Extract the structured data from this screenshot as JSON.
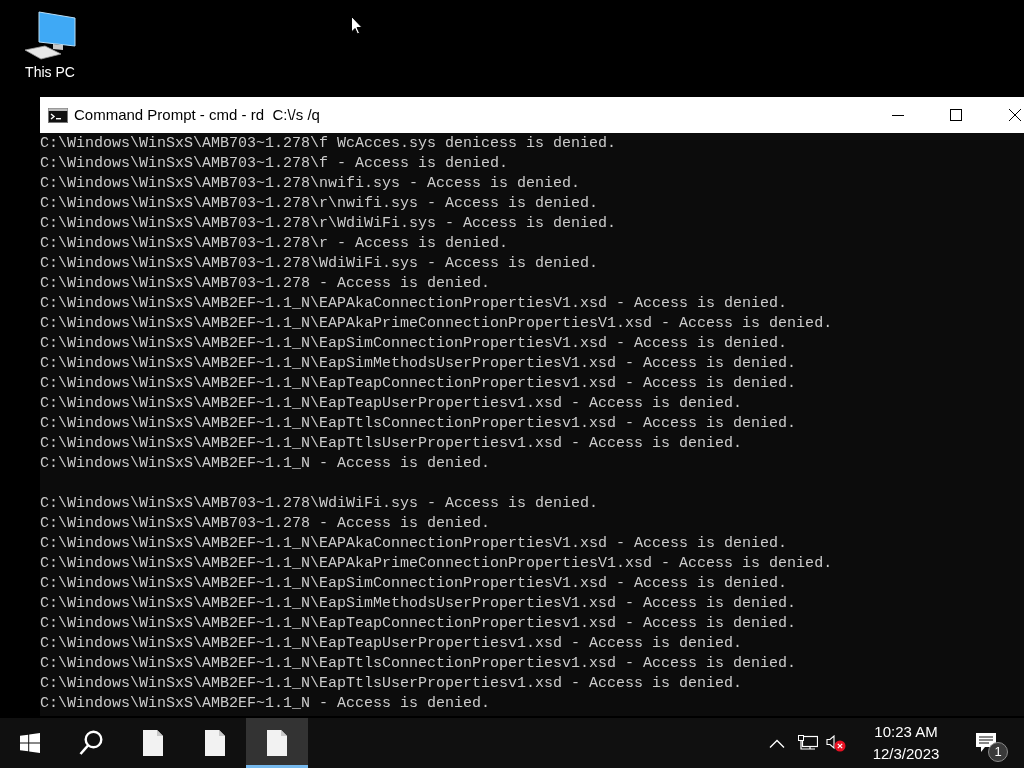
{
  "desktop": {
    "icons": [
      {
        "label": "This PC"
      }
    ]
  },
  "window": {
    "title": "Command Prompt - cmd - rd  C:\\/s /q",
    "console_blocks": [
      {
        "lines": [
          "C:\\Windows\\WinSxS\\AMB703~1.278\\f WcAcces.sys denicess is denied.",
          "C:\\Windows\\WinSxS\\AMB703~1.278\\f - Access is denied.",
          "C:\\Windows\\WinSxS\\AMB703~1.278\\nwifi.sys - Access is denied.",
          "C:\\Windows\\WinSxS\\AMB703~1.278\\r\\nwifi.sys - Access is denied.",
          "C:\\Windows\\WinSxS\\AMB703~1.278\\r\\WdiWiFi.sys - Access is denied.",
          "C:\\Windows\\WinSxS\\AMB703~1.278\\r - Access is denied.",
          "C:\\Windows\\WinSxS\\AMB703~1.278\\WdiWiFi.sys - Access is denied.",
          "C:\\Windows\\WinSxS\\AMB703~1.278 - Access is denied.",
          "C:\\Windows\\WinSxS\\AMB2EF~1.1_N\\EAPAkaConnectionPropertiesV1.xsd - Access is denied.",
          "C:\\Windows\\WinSxS\\AMB2EF~1.1_N\\EAPAkaPrimeConnectionPropertiesV1.xsd - Access is denied.",
          "C:\\Windows\\WinSxS\\AMB2EF~1.1_N\\EapSimConnectionPropertiesV1.xsd - Access is denied.",
          "C:\\Windows\\WinSxS\\AMB2EF~1.1_N\\EapSimMethodsUserPropertiesV1.xsd - Access is denied.",
          "C:\\Windows\\WinSxS\\AMB2EF~1.1_N\\EapTeapConnectionPropertiesv1.xsd - Access is denied.",
          "C:\\Windows\\WinSxS\\AMB2EF~1.1_N\\EapTeapUserPropertiesv1.xsd - Access is denied.",
          "C:\\Windows\\WinSxS\\AMB2EF~1.1_N\\EapTtlsConnectionPropertiesv1.xsd - Access is denied.",
          "C:\\Windows\\WinSxS\\AMB2EF~1.1_N\\EapTtlsUserPropertiesv1.xsd - Access is denied.",
          "C:\\Windows\\WinSxS\\AMB2EF~1.1_N - Access is denied."
        ]
      },
      {
        "lines": [
          "C:\\Windows\\WinSxS\\AMB703~1.278\\WdiWiFi.sys - Access is denied.",
          "C:\\Windows\\WinSxS\\AMB703~1.278 - Access is denied.",
          "C:\\Windows\\WinSxS\\AMB2EF~1.1_N\\EAPAkaConnectionPropertiesV1.xsd - Access is denied.",
          "C:\\Windows\\WinSxS\\AMB2EF~1.1_N\\EAPAkaPrimeConnectionPropertiesV1.xsd - Access is denied.",
          "C:\\Windows\\WinSxS\\AMB2EF~1.1_N\\EapSimConnectionPropertiesV1.xsd - Access is denied.",
          "C:\\Windows\\WinSxS\\AMB2EF~1.1_N\\EapSimMethodsUserPropertiesV1.xsd - Access is denied.",
          "C:\\Windows\\WinSxS\\AMB2EF~1.1_N\\EapTeapConnectionPropertiesv1.xsd - Access is denied.",
          "C:\\Windows\\WinSxS\\AMB2EF~1.1_N\\EapTeapUserPropertiesv1.xsd - Access is denied.",
          "C:\\Windows\\WinSxS\\AMB2EF~1.1_N\\EapTtlsConnectionPropertiesv1.xsd - Access is denied.",
          "C:\\Windows\\WinSxS\\AMB2EF~1.1_N\\EapTtlsUserPropertiesv1.xsd - Access is denied.",
          "C:\\Windows\\WinSxS\\AMB2EF~1.1_N - Access is denied."
        ]
      }
    ]
  },
  "taskbar": {
    "apps": [
      {
        "selected": false
      },
      {
        "selected": false
      },
      {
        "selected": true
      }
    ],
    "tray": {
      "volume": {
        "muted": true
      },
      "clock": {
        "time": "10:23 AM",
        "date": "12/3/2023"
      },
      "notifications": {
        "count": "1"
      }
    }
  }
}
